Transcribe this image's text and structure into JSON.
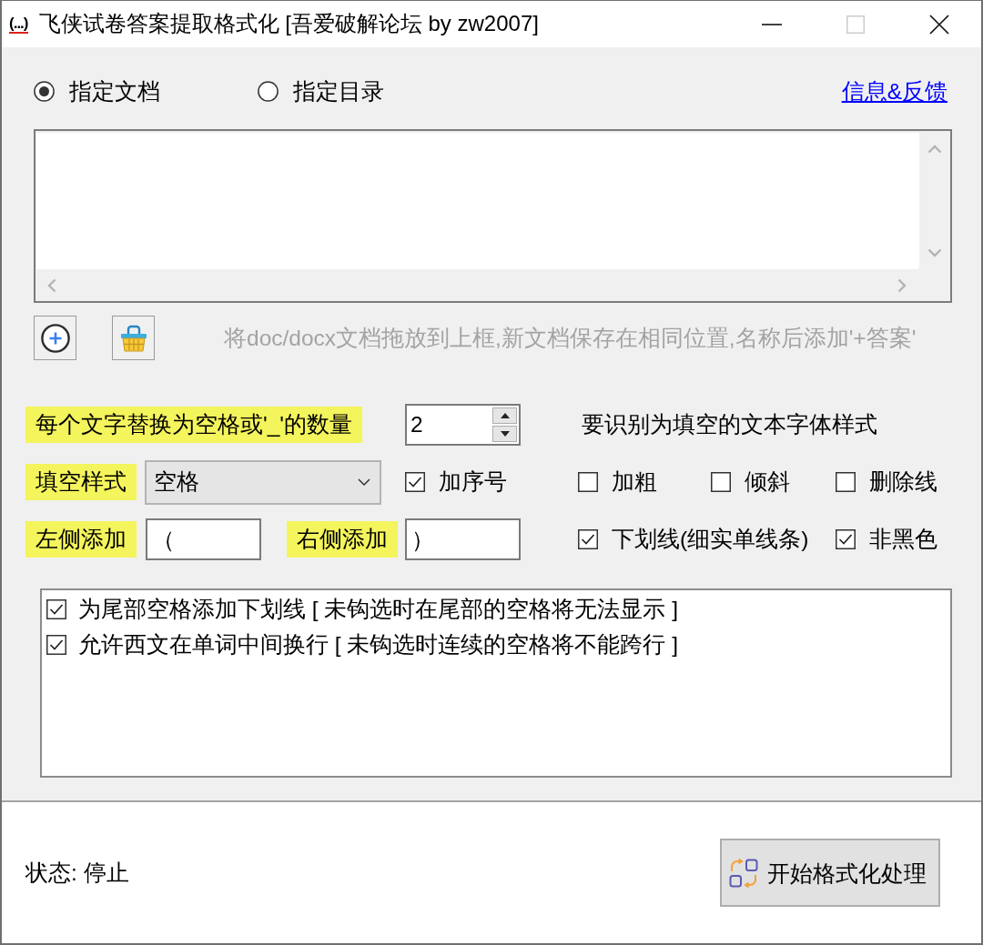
{
  "window": {
    "logo": "(...)",
    "title": "飞侠试卷答案提取格式化 [吾爱破解论坛 by zw2007]",
    "controls": [
      {
        "kind": "minimize",
        "disabled": false
      },
      {
        "kind": "maximize",
        "disabled": true
      },
      {
        "kind": "close",
        "disabled": false
      }
    ]
  },
  "source": {
    "radios": [
      {
        "label": "指定文档",
        "selected": true
      },
      {
        "label": "指定目录",
        "selected": false
      }
    ],
    "link": "信息&反馈"
  },
  "drop_hint": "将doc/docx文档拖放到上框,新文档保存在相同位置,名称后添加'+答案'",
  "settings": {
    "count": {
      "label": "每个文字替换为空格或'_'的数量",
      "value": "2"
    },
    "fill_style": {
      "label": "填空样式",
      "value": "空格"
    },
    "add_number": {
      "label": "加序号",
      "checked": true
    },
    "left_add": {
      "label": "左侧添加",
      "value": "（"
    },
    "right_add": {
      "label": "右侧添加",
      "value": "）"
    },
    "font_style": {
      "heading": "要识别为填空的文本字体样式",
      "options": [
        {
          "label": "加粗",
          "checked": false
        },
        {
          "label": "倾斜",
          "checked": false
        },
        {
          "label": "删除线",
          "checked": false
        },
        {
          "label": "下划线(细实单线条)",
          "checked": true
        },
        {
          "label": "非黑色",
          "checked": true
        }
      ]
    }
  },
  "options": [
    {
      "label": "为尾部空格添加下划线 [ 未钩选时在尾部的空格将无法显示 ]",
      "checked": true
    },
    {
      "label": "允许西文在单词中间换行 [ 未钩选时连续的空格将不能跨行 ]",
      "checked": true
    }
  ],
  "status_bar": {
    "status": "状态: 停止",
    "start_button": "开始格式化处理"
  }
}
